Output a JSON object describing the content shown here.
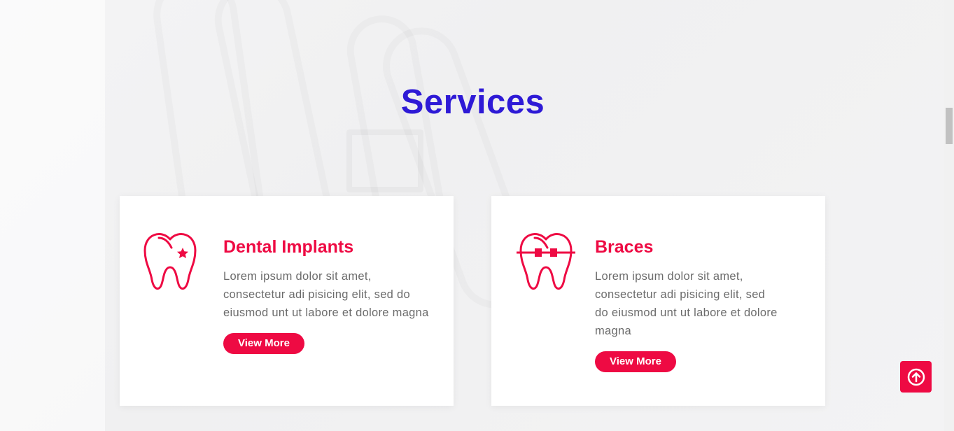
{
  "section": {
    "title": "Services"
  },
  "services": [
    {
      "icon": "tooth-star-icon",
      "title": "Dental Implants",
      "description": "Lorem ipsum dolor sit amet, consectetur adi pisicing elit, sed do eiusmod unt ut labore et dolore magna",
      "button_label": "View More"
    },
    {
      "icon": "tooth-braces-icon",
      "title": "Braces",
      "description": "Lorem ipsum dolor sit amet, consectetur adi pisicing elit, sed do eiusmod unt ut labore et dolore magna",
      "button_label": "View More"
    }
  ],
  "scroll_top_icon": "arrow-up-circle-icon",
  "colors": {
    "title": "#2e1ad6",
    "accent": "#ee0a43",
    "body_text": "#6b6b6b"
  }
}
